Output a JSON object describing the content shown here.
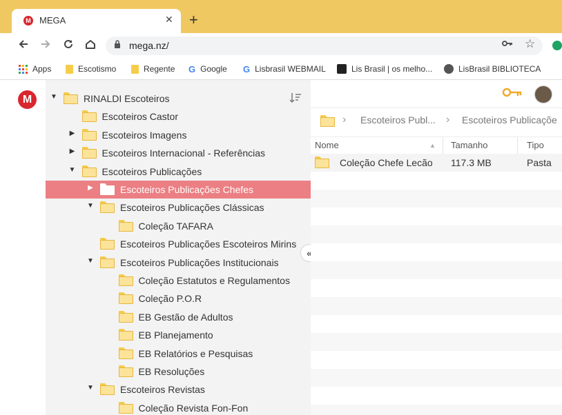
{
  "browser": {
    "tab_title": "MEGA",
    "tab_favicon": "M",
    "tab_close": "✕",
    "new_tab": "+",
    "url": "mega.nz/",
    "colors": {
      "tabstrip": "#f0c861",
      "mega_red": "#d9272e"
    }
  },
  "bookmarks": [
    {
      "label": "Apps",
      "icon": "apps-grid-icon"
    },
    {
      "label": "Escotismo",
      "icon": "folder-icon"
    },
    {
      "label": "Regente",
      "icon": "folder-icon"
    },
    {
      "label": "Google",
      "icon": "google-icon"
    },
    {
      "label": "Lisbrasil WEBMAIL",
      "icon": "google-icon"
    },
    {
      "label": "Lis Brasil | os melho...",
      "icon": "site-icon"
    },
    {
      "label": "LisBrasil BIBLIOTECA",
      "icon": "globe-icon"
    }
  ],
  "mega": {
    "logo": "M",
    "tree": [
      {
        "label": "RINALDI Escoteiros",
        "arrow": "▼"
      },
      {
        "label": "Escoteiros Castor",
        "arrow": ""
      },
      {
        "label": "Escoteiros Imagens",
        "arrow": "▶"
      },
      {
        "label": "Escoteiros Internacional - Referências",
        "arrow": "▶"
      },
      {
        "label": "Escoteiros Publicações",
        "arrow": "▼"
      },
      {
        "label": "Escoteiros Publicações Chefes",
        "arrow": "▶",
        "selected": true
      },
      {
        "label": "Escoteiros Publicações Clássicas",
        "arrow": "▼"
      },
      {
        "label": "Coleção TAFARA",
        "arrow": ""
      },
      {
        "label": "Escoteiros Publicações Escoteiros Mirins",
        "arrow": ""
      },
      {
        "label": "Escoteiros Publicações Institucionais",
        "arrow": "▼"
      },
      {
        "label": "Coleção Estatutos e Regulamentos",
        "arrow": ""
      },
      {
        "label": "Coleção P.O.R",
        "arrow": ""
      },
      {
        "label": "EB Gestão de Adultos",
        "arrow": ""
      },
      {
        "label": "EB Planejamento",
        "arrow": ""
      },
      {
        "label": "EB Relatórios e Pesquisas",
        "arrow": ""
      },
      {
        "label": "EB Resoluções",
        "arrow": ""
      },
      {
        "label": "Escoteiros Revistas",
        "arrow": "▼"
      },
      {
        "label": "Coleção Revista Fon-Fon",
        "arrow": ""
      }
    ],
    "collapse_icon": "«",
    "breadcrumb": [
      "Escoteiros Publ...",
      "Escoteiros Publicaçõe"
    ],
    "columns": {
      "name": "Nome",
      "size": "Tamanho",
      "type": "Tipo"
    },
    "files": [
      {
        "name": "Coleção Chefe Lecão",
        "size": "117.3 MB",
        "type": "Pasta"
      }
    ]
  }
}
